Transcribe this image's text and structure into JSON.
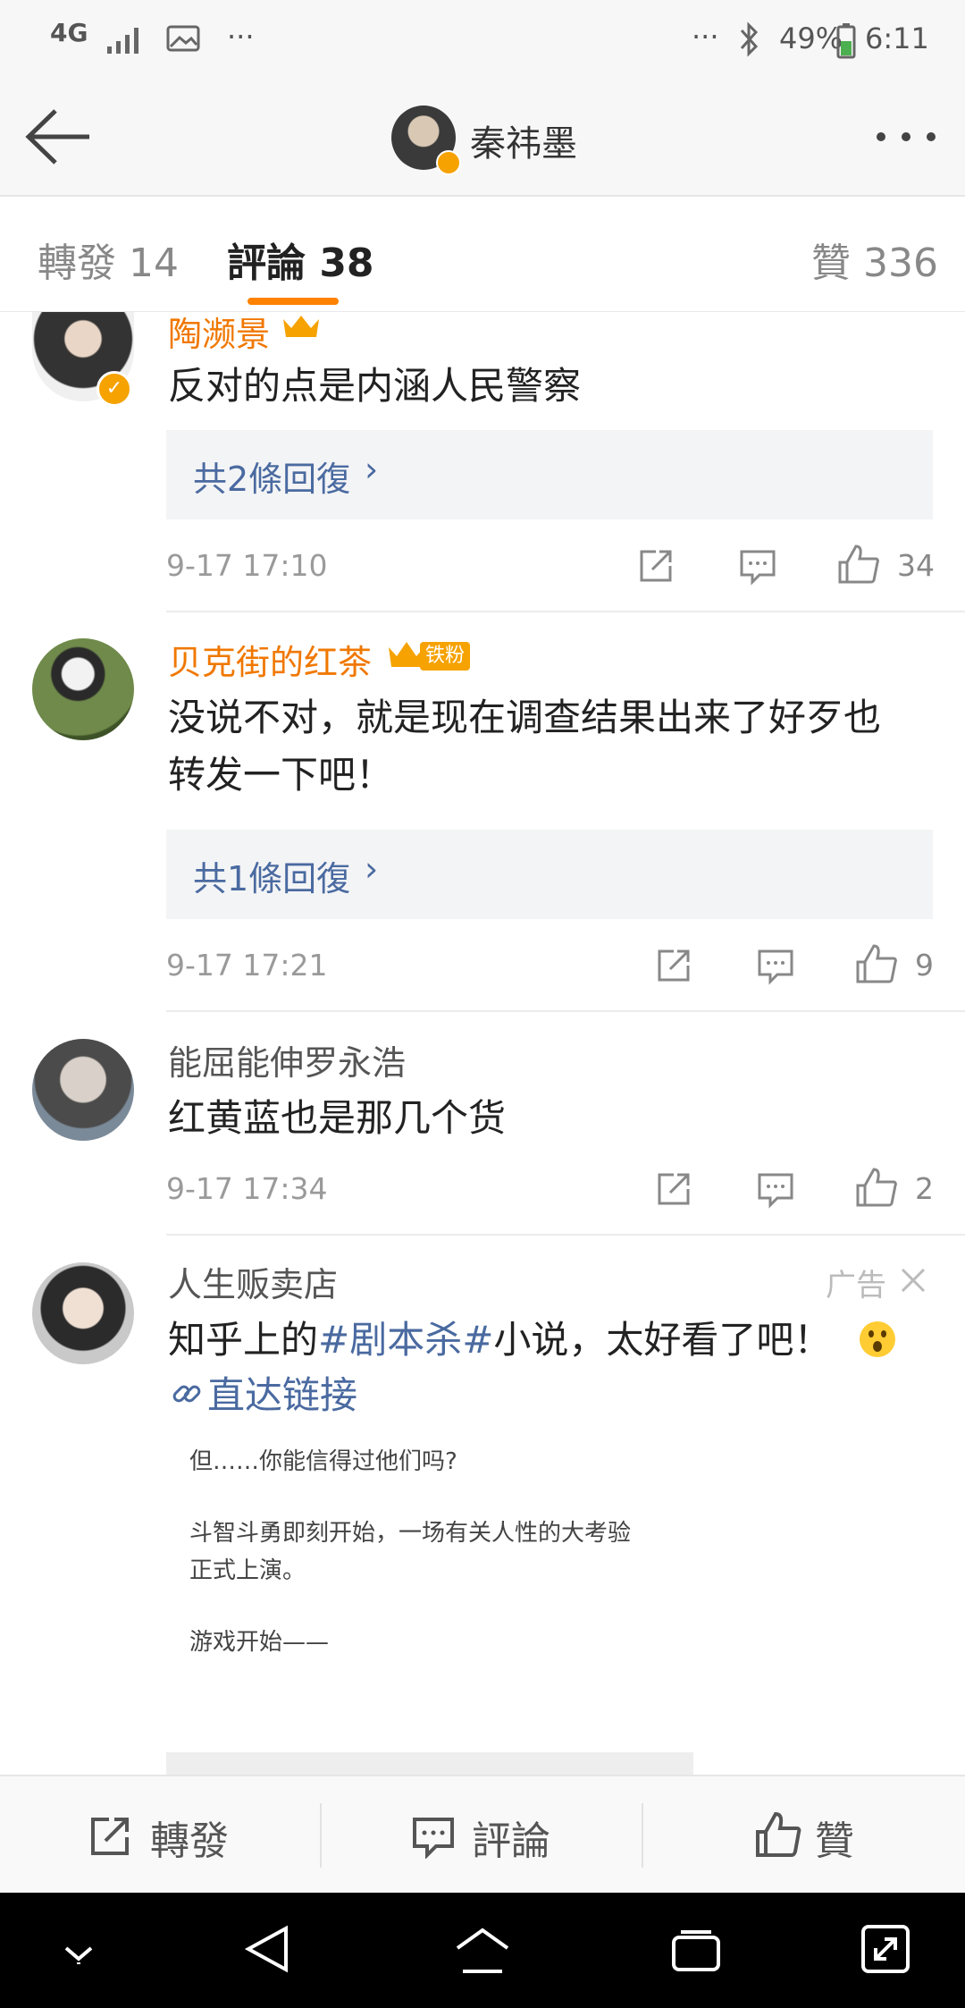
{
  "status_bar": {
    "network": "4G",
    "more_left": "···",
    "more_right": "···",
    "battery": "49%",
    "time": "6:11"
  },
  "header": {
    "title": "秦祎墨"
  },
  "tabs": {
    "repost": "轉發 14",
    "comment": "評論 38",
    "like": "贊 336"
  },
  "comments": [
    {
      "user": "陶濒景",
      "text": "反对的点是内涵人民警察",
      "replies": "共2條回復",
      "time": "9-17 17:10",
      "likes": "34"
    },
    {
      "user": "贝克街的红茶",
      "badge": "铁粉",
      "text_line1": "没说不对，就是现在调查结果出来了好歹也",
      "text_line2": "转发一下吧！",
      "replies": "共1條回復",
      "time": "9-17 17:21",
      "likes": "9"
    },
    {
      "user": "能屈能伸罗永浩",
      "text": "红黄蓝也是那几个货",
      "time": "9-17 17:34",
      "likes": "2"
    }
  ],
  "ad": {
    "user": "人生贩卖店",
    "label": "广告",
    "text_prefix": "知乎上的",
    "hashtag": "#剧本杀#",
    "text_suffix": "小说，太好看了吧！",
    "link": "直达链接",
    "image_lines": [
      "但……你能信得过他们吗?",
      "斗智斗勇即刻开始，一场有关人性的大考验",
      "正式上演。",
      "游戏开始——"
    ]
  },
  "bottom_bar": {
    "repost": "轉發",
    "comment": "評論",
    "like": "贊"
  },
  "colors": {
    "accent": "#ff8200",
    "link": "#4a6aa0",
    "vip_name": "#f07800"
  }
}
